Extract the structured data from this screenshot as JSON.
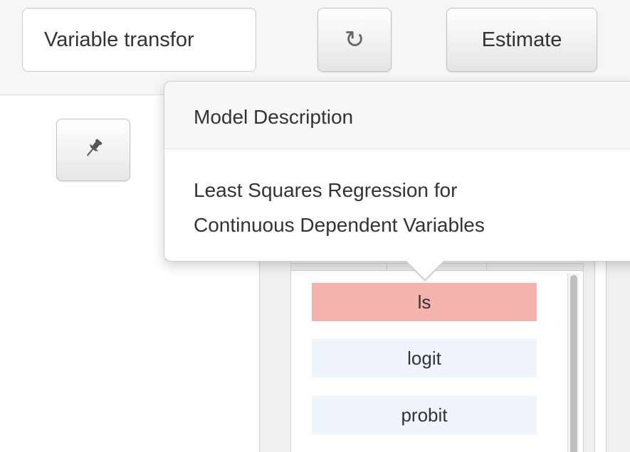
{
  "toolbar": {
    "variable_input_value": "Variable transfor",
    "refresh_icon": "refresh-icon",
    "estimate_label": "Estimate"
  },
  "pin_button": {
    "icon": "pin-icon"
  },
  "popover": {
    "title": "Model Description",
    "body_line1": "Least Squares Regression for",
    "body_line2": "Continuous Dependent Variables"
  },
  "models": {
    "items": [
      {
        "label": "ls",
        "selected": true
      },
      {
        "label": "logit",
        "selected": false
      },
      {
        "label": "probit",
        "selected": false
      }
    ]
  },
  "colors": {
    "selected_item": "#f5b3ae",
    "unselected_item": "#eef5fc"
  }
}
